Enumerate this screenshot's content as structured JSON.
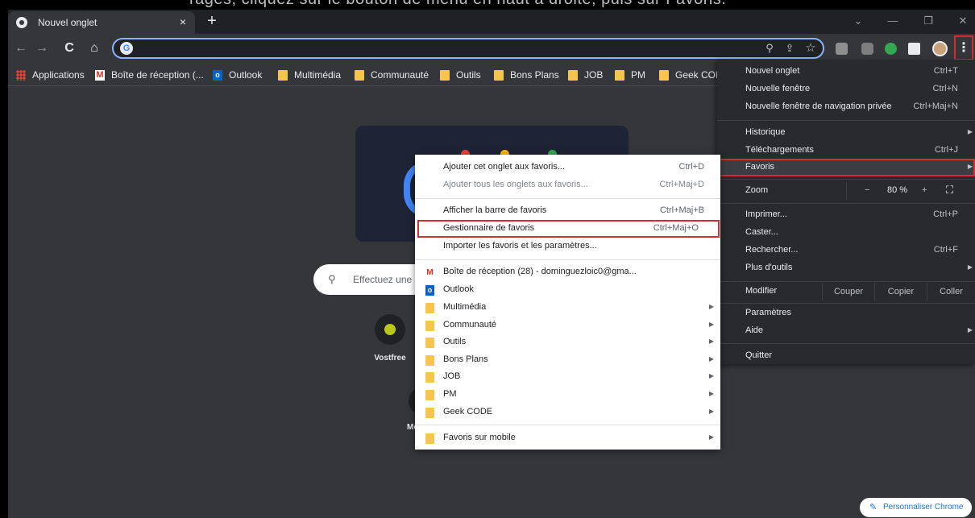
{
  "top_fragment": "rages, cliquez sur le bouton de menu en haut à droite, puis sur Favoris.",
  "tab": {
    "title": "Nouvel onglet",
    "close": "×",
    "new_tab": "+"
  },
  "window_controls": {
    "dropdown": "⌄",
    "minimize": "—",
    "restore": "❐",
    "close": "✕"
  },
  "nav": {
    "back": "←",
    "forward": "→",
    "reload": "C",
    "home": "⌂"
  },
  "omnibox": {
    "g": "G",
    "zoom": "⚲",
    "share": "⇪",
    "star": "☆"
  },
  "menu_button": "⋮",
  "bookmarks_bar": [
    {
      "label": "Applications",
      "icon": "apps-icon"
    },
    {
      "label": "Boîte de réception (...",
      "icon": "gmail-icon"
    },
    {
      "label": "Outlook",
      "icon": "outlook-icon"
    },
    {
      "label": "Multimédia",
      "icon": "folder-icon"
    },
    {
      "label": "Communauté",
      "icon": "folder-icon"
    },
    {
      "label": "Outils",
      "icon": "folder-icon"
    },
    {
      "label": "Bons Plans",
      "icon": "folder-icon"
    },
    {
      "label": "JOB",
      "icon": "folder-icon"
    },
    {
      "label": "PM",
      "icon": "folder-icon"
    },
    {
      "label": "Geek COD",
      "icon": "folder-icon"
    }
  ],
  "ntp": {
    "search_placeholder": "Effectuez une",
    "shortcut_label": "Vostfree",
    "shortcut2_label": "Me",
    "customize": "Personnaliser Chrome"
  },
  "main_menu": {
    "new_tab": "Nouvel onglet",
    "new_tab_sc": "Ctrl+T",
    "new_window": "Nouvelle fenêtre",
    "new_window_sc": "Ctrl+N",
    "incognito": "Nouvelle fenêtre de navigation privée",
    "incognito_sc": "Ctrl+Maj+N",
    "history": "Historique",
    "downloads": "Téléchargements",
    "downloads_sc": "Ctrl+J",
    "bookmarks": "Favoris",
    "zoom": "Zoom",
    "zoom_minus": "−",
    "zoom_value": "80 %",
    "zoom_plus": "+",
    "fullscreen": "⛶",
    "print": "Imprimer...",
    "print_sc": "Ctrl+P",
    "cast": "Caster...",
    "find": "Rechercher...",
    "find_sc": "Ctrl+F",
    "more_tools": "Plus d'outils",
    "edit": "Modifier",
    "cut": "Couper",
    "copy": "Copier",
    "paste": "Coller",
    "settings": "Paramètres",
    "help": "Aide",
    "quit": "Quitter"
  },
  "bookmarks_menu": {
    "add_tab": "Ajouter cet onglet aux favoris...",
    "add_tab_sc": "Ctrl+D",
    "add_all": "Ajouter tous les onglets aux favoris...",
    "add_all_sc": "Ctrl+Maj+D",
    "show_bar": "Afficher la barre de favoris",
    "show_bar_sc": "Ctrl+Maj+B",
    "manager": "Gestionnaire de favoris",
    "manager_sc": "Ctrl+Maj+O",
    "import": "Importer les favoris et les paramètres...",
    "items": [
      {
        "label": "Boîte de réception (28) - dominguezloic0@gma...",
        "icon": "gmail-icon",
        "arrow": false
      },
      {
        "label": "Outlook",
        "icon": "outlook-icon",
        "arrow": false
      },
      {
        "label": "Multimédia",
        "icon": "folder-icon",
        "arrow": true
      },
      {
        "label": "Communauté",
        "icon": "folder-icon",
        "arrow": true
      },
      {
        "label": "Outils",
        "icon": "folder-icon",
        "arrow": true
      },
      {
        "label": "Bons Plans",
        "icon": "folder-icon",
        "arrow": true
      },
      {
        "label": "JOB",
        "icon": "folder-icon",
        "arrow": true
      },
      {
        "label": "PM",
        "icon": "folder-icon",
        "arrow": true
      },
      {
        "label": "Geek CODE",
        "icon": "folder-icon",
        "arrow": true
      }
    ],
    "mobile": "Favoris sur mobile",
    "submenu_arrow": "▶"
  },
  "colors": {
    "accent": "#8ab4f8",
    "highlight_border": "#d02f2f",
    "folder": "#f6c54e"
  }
}
